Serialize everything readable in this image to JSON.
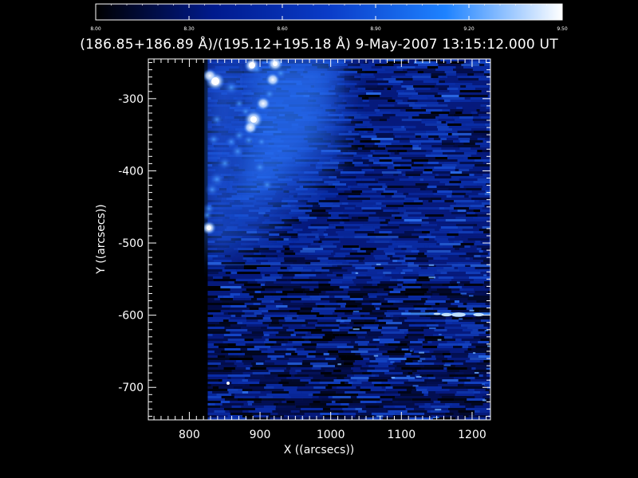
{
  "chart_data": {
    "type": "heatmap",
    "title": "(186.85+186.89 Å)/(195.12+195.18 Å)  9-May-2007 13:15:12.000 UT",
    "xlabel": "X ((arcsecs))",
    "ylabel": "Y ((arcsecs))",
    "xlim": [
      742,
      1226
    ],
    "ylim": [
      -745,
      -245
    ],
    "x_ticks": [
      800,
      900,
      1000,
      1100,
      1200
    ],
    "y_ticks": [
      -300,
      -400,
      -500,
      -600,
      -700
    ],
    "x_tick_labels": [
      "800",
      "900",
      "1000",
      "1100",
      "1200"
    ],
    "y_tick_labels": [
      "-300",
      "-400",
      "-500",
      "-600",
      "-700"
    ],
    "data_x_start": 826,
    "colorbar": {
      "range": [
        8.0,
        9.5
      ],
      "ticks": [
        8.0,
        8.3,
        8.6,
        8.9,
        9.2,
        9.5
      ],
      "tick_labels": [
        "8.00",
        "8.30",
        "8.60",
        "8.90",
        "9.20",
        "9.50"
      ],
      "colors": [
        "#000000",
        "#001a8c",
        "#0a3cc8",
        "#1e82ff",
        "#ffffff"
      ]
    },
    "features": [
      {
        "name": "bright loop footpoints",
        "x": [
          845,
          890,
          920,
          893
        ],
        "y": [
          -270,
          -250,
          -250,
          -325
        ]
      },
      {
        "name": "faint horizontal streak",
        "y": -598,
        "x": [
          1100,
          1226
        ]
      }
    ]
  }
}
